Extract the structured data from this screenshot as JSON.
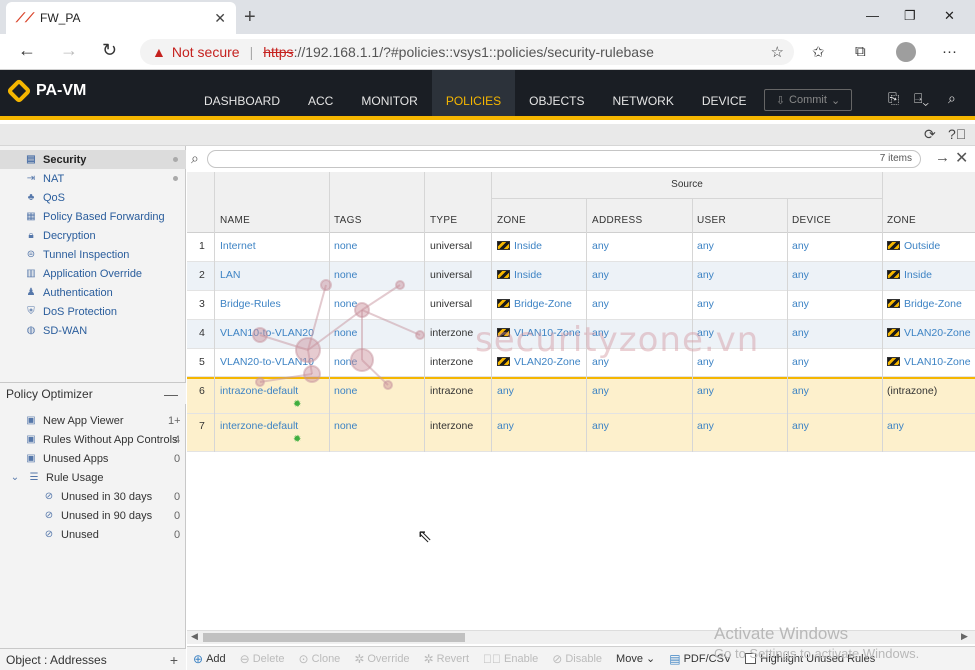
{
  "browser": {
    "tab_title": "FW_PA",
    "url_warning": "Not secure",
    "url_scheme": "https",
    "url_rest": "://192.168.1.1/?#policies::vsys1::policies/security-rulebase"
  },
  "app": {
    "logo": "PA-VM",
    "nav": [
      "DASHBOARD",
      "ACC",
      "MONITOR",
      "POLICIES",
      "OBJECTS",
      "NETWORK",
      "DEVICE"
    ],
    "active_nav": "POLICIES",
    "commit_label": "Commit",
    "accent": "#f5b600"
  },
  "sidebar": {
    "items": [
      {
        "label": "Security",
        "icon": "shield-icon",
        "active": true
      },
      {
        "label": "NAT",
        "icon": "arrow-icon"
      },
      {
        "label": "QoS",
        "icon": "qos-icon"
      },
      {
        "label": "Policy Based Forwarding",
        "icon": "pbf-icon"
      },
      {
        "label": "Decryption",
        "icon": "lock-icon"
      },
      {
        "label": "Tunnel Inspection",
        "icon": "tunnel-icon"
      },
      {
        "label": "Application Override",
        "icon": "app-icon"
      },
      {
        "label": "Authentication",
        "icon": "auth-icon"
      },
      {
        "label": "DoS Protection",
        "icon": "dos-icon"
      },
      {
        "label": "SD-WAN",
        "icon": "globe-icon"
      }
    ],
    "optimizer_title": "Policy Optimizer",
    "optimizer_items": [
      {
        "label": "New App Viewer",
        "count": "1+"
      },
      {
        "label": "Rules Without App Controls",
        "count": "4"
      },
      {
        "label": "Unused Apps",
        "count": "0"
      },
      {
        "label": "Rule Usage",
        "count": ""
      },
      {
        "label": "Unused in 30 days",
        "count": "0"
      },
      {
        "label": "Unused in 90 days",
        "count": "0"
      },
      {
        "label": "Unused",
        "count": "0"
      }
    ],
    "bottom_label": "Object : Addresses"
  },
  "search": {
    "count": "7 items"
  },
  "table": {
    "group_source": "Source",
    "headers": {
      "name": "NAME",
      "tags": "TAGS",
      "type": "TYPE",
      "zone": "ZONE",
      "address": "ADDRESS",
      "user": "USER",
      "device": "DEVICE",
      "dest_zone": "ZONE"
    },
    "rows": [
      {
        "num": "1",
        "name": "Internet",
        "tags": "none",
        "type": "universal",
        "zone": "Inside",
        "address": "any",
        "user": "any",
        "device": "any",
        "dest_zone": "Outside"
      },
      {
        "num": "2",
        "name": "LAN",
        "tags": "none",
        "type": "universal",
        "zone": "Inside",
        "address": "any",
        "user": "any",
        "device": "any",
        "dest_zone": "Inside"
      },
      {
        "num": "3",
        "name": "Bridge-Rules",
        "tags": "none",
        "type": "universal",
        "zone": "Bridge-Zone",
        "address": "any",
        "user": "any",
        "device": "any",
        "dest_zone": "Bridge-Zone"
      },
      {
        "num": "4",
        "name": "VLAN10-to-VLAN20",
        "tags": "none",
        "type": "interzone",
        "zone": "VLAN10-Zone",
        "address": "any",
        "user": "any",
        "device": "any",
        "dest_zone": "VLAN20-Zone"
      },
      {
        "num": "5",
        "name": "VLAN20-to-VLAN10",
        "tags": "none",
        "type": "interzone",
        "zone": "VLAN20-Zone",
        "address": "any",
        "user": "any",
        "device": "any",
        "dest_zone": "VLAN10-Zone"
      },
      {
        "num": "6",
        "name": "intrazone-default",
        "tags": "none",
        "type": "intrazone",
        "zone": "any",
        "address": "any",
        "user": "any",
        "device": "any",
        "dest_zone": "(intrazone)"
      },
      {
        "num": "7",
        "name": "interzone-default",
        "tags": "none",
        "type": "interzone",
        "zone": "any",
        "address": "any",
        "user": "any",
        "device": "any",
        "dest_zone": "any"
      }
    ]
  },
  "footer": {
    "add": "Add",
    "delete": "Delete",
    "clone": "Clone",
    "override": "Override",
    "revert": "Revert",
    "enable": "Enable",
    "disable": "Disable",
    "move": "Move",
    "pdf": "PDF/CSV",
    "highlight": "Highlight Unused Rules"
  },
  "overlay": {
    "activate_title": "Activate Windows",
    "activate_sub": "Go to Settings to activate Windows.",
    "watermark": "securityzone.vn"
  }
}
